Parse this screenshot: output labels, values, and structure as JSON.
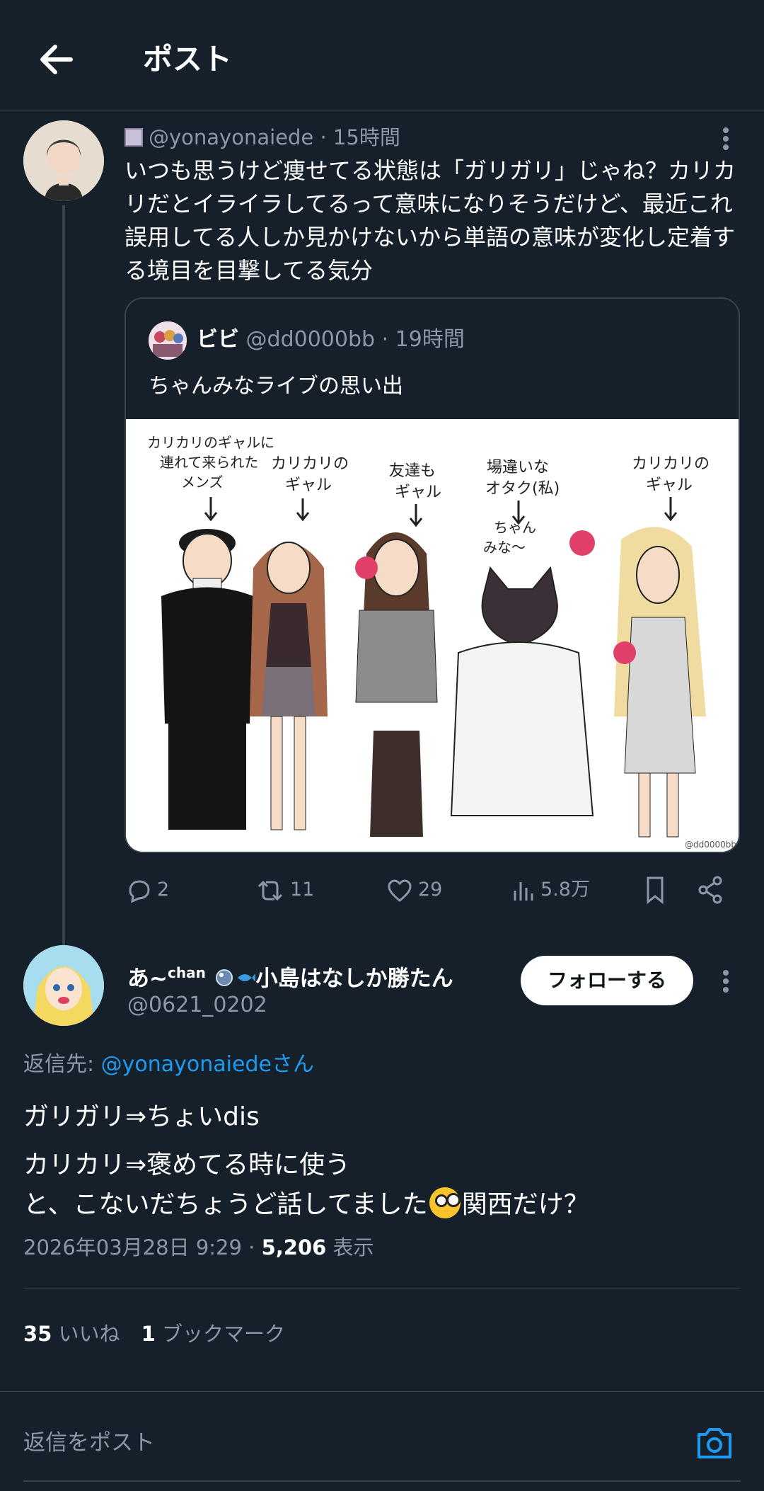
{
  "header": {
    "title": "ポスト",
    "back_icon": "arrow-left-icon"
  },
  "post1": {
    "handle_meta": "@yonayonaiede · 15時間",
    "text": "いつも思うけど痩せてる状態は「ガリガリ」じゃね？カリカリだとイライラしてるって意味になりそうだけど、最近これ誤用してる人しか見かけないから単語の意味が変化し定着する境目を目撃してる気分",
    "quote": {
      "name": "ビビ",
      "handle_meta": "@dd0000bb · 19時間",
      "text": "ちゃんみなライブの思い出",
      "image_labels": {
        "label1": "カリカリのギャルに\n連れて来られた\nメンズ",
        "label2": "カリカリの\nギャル",
        "label3": "友達も\nギャル",
        "label4": "場違いな\nオタク(私)",
        "label5": "カリカリの\nギャル",
        "cat_speech": "ちゃん\nみな〜",
        "watermark": "@dd0000bb"
      }
    },
    "actions": {
      "replies": "2",
      "reposts": "11",
      "likes": "29",
      "views": "5.8万"
    }
  },
  "post2": {
    "name": "あ~",
    "name_sup": "chan",
    "name_rest": "小島はなしか勝たん",
    "handle": "@0621_0202",
    "follow_label": "フォローする",
    "reply_to_label": "返信先: ",
    "reply_to_link": "@yonayonaiedeさん",
    "body_line1": "ガリガリ⇒ちょいdis",
    "body_line2": "カリカリ⇒褒めてる時に使う",
    "body_line3a": "と、こないだちょうど話してました",
    "body_line3b": "関西だけ？",
    "timestamp": "2026年03月28日 9:29 · ",
    "views_count": "5,206",
    "views_label": " 表示",
    "likes_count": "35",
    "likes_label": " いいね",
    "bookmarks_count": "1",
    "bookmarks_label": " ブックマーク"
  },
  "reply_bar": {
    "placeholder": "返信をポスト"
  },
  "colors": {
    "background": "#15202b",
    "accent": "#1d9bf0",
    "muted": "#8b98a5",
    "border": "#38444d"
  }
}
